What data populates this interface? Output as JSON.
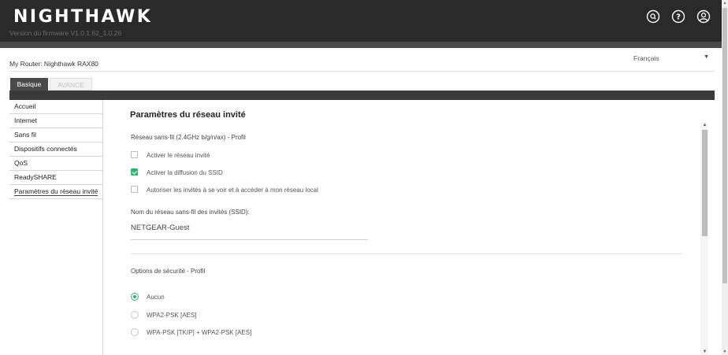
{
  "header": {
    "logo": "NIGHTHAWK",
    "firmware": "Version du firmware V1.0.1.62_1.0.26",
    "icons": [
      "search-icon",
      "help-icon",
      "user-icon"
    ]
  },
  "router": {
    "label": "My Router: Nighthawk RAX80"
  },
  "language": {
    "selected": "Français",
    "arrow": "▼"
  },
  "tabs": {
    "basic": "Basique",
    "advanced": "AVANCE"
  },
  "sidebar": {
    "items": [
      {
        "label": "Accueil"
      },
      {
        "label": "Internet"
      },
      {
        "label": "Sans fil"
      },
      {
        "label": "Dispositifs connectés"
      },
      {
        "label": "QoS"
      },
      {
        "label": "ReadySHARE"
      },
      {
        "label": "Paramètres du réseau invité"
      }
    ]
  },
  "main": {
    "title": "Paramètres du réseau invité",
    "wireless_profile": "Réseau sans-fil (2.4GHz b/g/n/ax) - Profil",
    "options": [
      {
        "label": "Activer le réseau invité",
        "checked": false
      },
      {
        "label": "Activer la diffusion du SSID",
        "checked": true
      },
      {
        "label": "Autoriser les invités à se voir et à accéder à mon réseau local",
        "checked": false
      }
    ],
    "ssid_label": "Nom du réseau sans-fil des invités (SSID):",
    "ssid_value": "NETGEAR-Guest",
    "security_label": "Options de sécurité - Profil",
    "security_options": [
      {
        "label": "Aucun",
        "selected": true
      },
      {
        "label": "WPA2-PSK [AES]",
        "selected": false
      },
      {
        "label": "WPA-PSK [TKIP] + WPA2-PSK [AES]",
        "selected": false
      }
    ]
  },
  "colors": {
    "accent": "#2bb673",
    "header_bg": "#2a2a2a",
    "tab_active": "#4a4a4a"
  }
}
